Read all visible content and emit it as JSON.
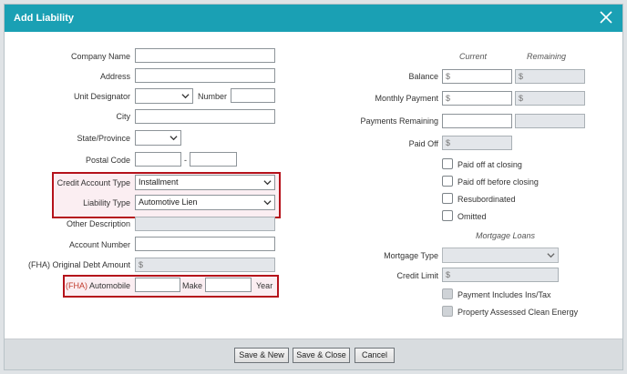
{
  "dialog": {
    "title": "Add Liability"
  },
  "left": {
    "company_name_label": "Company Name",
    "address_label": "Address",
    "unit_designator_label": "Unit Designator",
    "number_label": "Number",
    "city_label": "City",
    "state_label": "State/Province",
    "postal_code_label": "Postal Code",
    "postal_dash": "-",
    "credit_account_type_label": "Credit Account Type",
    "credit_account_type_value": "Installment",
    "liability_type_label": "Liability Type",
    "liability_type_value": "Automotive Lien",
    "other_description_label": "Other Description",
    "account_number_label": "Account Number",
    "original_debt_label": "(FHA) Original Debt Amount",
    "original_debt_placeholder": "$",
    "automobile_prefix": "(FHA)",
    "automobile_label": "Automobile",
    "make_label": "Make",
    "year_label": "Year"
  },
  "right": {
    "current_header": "Current",
    "remaining_header": "Remaining",
    "balance_label": "Balance",
    "balance_current_placeholder": "$",
    "balance_remaining_placeholder": "$",
    "monthly_payment_label": "Monthly Payment",
    "monthly_payment_current_placeholder": "$",
    "monthly_payment_remaining_placeholder": "$",
    "payments_remaining_label": "Payments Remaining",
    "paid_off_label": "Paid Off",
    "paid_off_placeholder": "$",
    "checkboxes": {
      "paid_off_at_closing": "Paid off at closing",
      "paid_off_before_closing": "Paid off before closing",
      "resubordinated": "Resubordinated",
      "omitted": "Omitted"
    },
    "mortgage_loans_header": "Mortgage Loans",
    "mortgage_type_label": "Mortgage Type",
    "credit_limit_label": "Credit Limit",
    "credit_limit_placeholder": "$",
    "payment_includes_label": "Payment Includes Ins/Tax",
    "pace_label": "Property Assessed Clean Energy"
  },
  "footer": {
    "save_new": "Save & New",
    "save_close": "Save & Close",
    "cancel": "Cancel"
  },
  "colors": {
    "titlebar": "#1aa0b4",
    "highlight_border": "#b5121b",
    "highlight_fill": "#fbeef2"
  },
  "icons": {
    "close": "close-icon",
    "dropdown": "chevron-down-icon"
  }
}
